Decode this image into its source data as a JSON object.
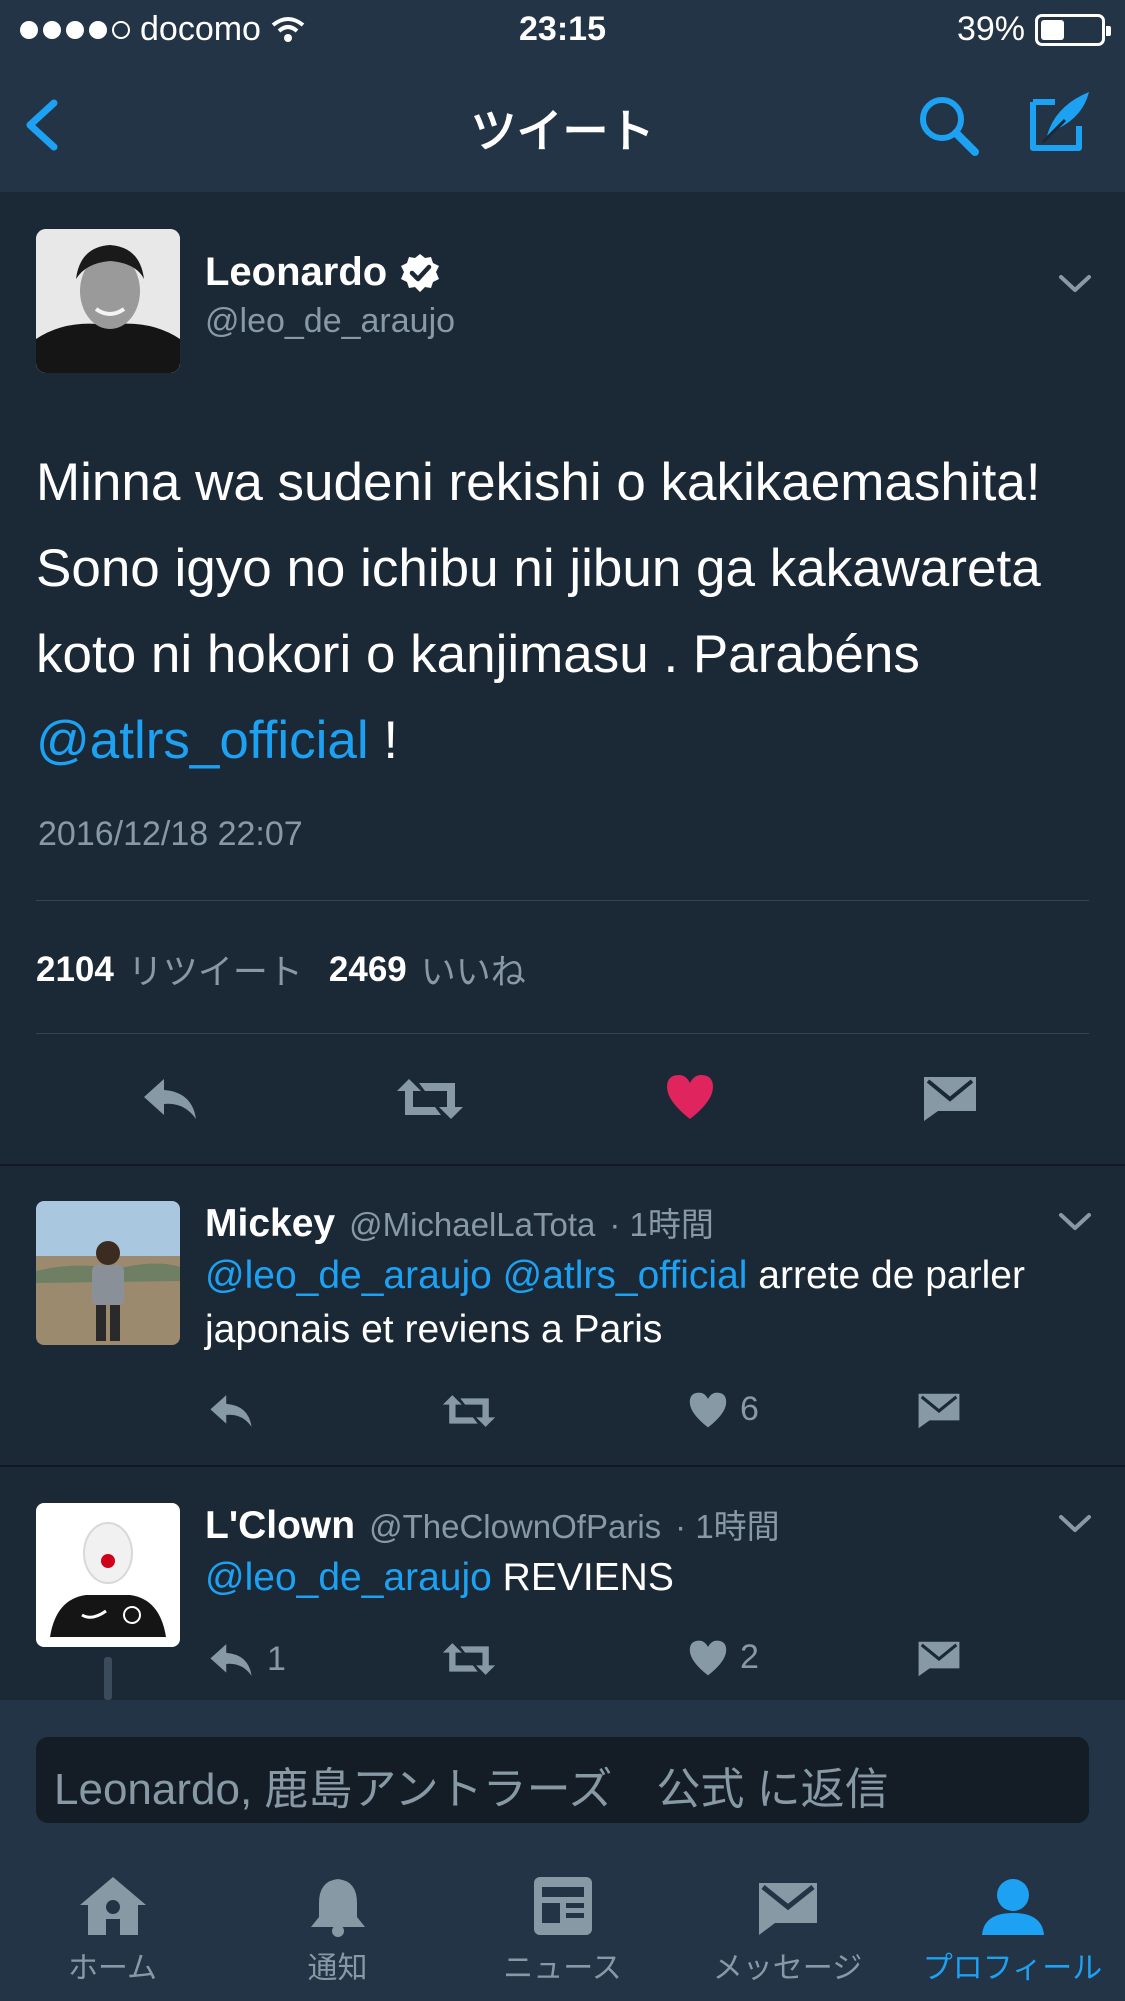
{
  "status_bar": {
    "carrier": "docomo",
    "time": "23:15",
    "battery": "39%",
    "battery_level": 0.39
  },
  "navbar": {
    "title": "ツイート",
    "back_icon": "chevron-left-icon",
    "search_icon": "search-icon",
    "compose_icon": "compose-icon"
  },
  "tweet": {
    "author_name": "Leonardo",
    "author_handle": "@leo_de_araujo",
    "text_before_mention": "Minna wa sudeni rekishi o kakikaemashita! Sono igyo no ichibu ni jibun ga kakawareta koto ni hokori o kanjimasu . Parabéns ",
    "mention": "@atlrs_official",
    "text_after_mention": " !",
    "date": "2016/12/18 22:07",
    "retweet_count": "2104",
    "retweet_label": "リツイート",
    "like_count": "2469",
    "like_label": "いいね",
    "liked": true
  },
  "replies": [
    {
      "name": "Mickey",
      "handle": "@MichaelLaTota",
      "time": "· 1時間",
      "mention1": "@leo_de_araujo",
      "mention2": "@atlrs_official",
      "text": " arrete de parler japonais et reviens a Paris",
      "reply_count": "",
      "like_count": "6"
    },
    {
      "name": "L'Clown",
      "handle": "@TheClownOfParis",
      "time": "· 1時間",
      "mention1": "@leo_de_araujo",
      "text": " REVIENS",
      "reply_count": "1",
      "like_count": "2"
    }
  ],
  "reply_box": {
    "placeholder": "Leonardo, 鹿島アントラーズ　公式 に返信"
  },
  "tabs": [
    {
      "label": "ホーム",
      "icon": "home-icon"
    },
    {
      "label": "通知",
      "icon": "bell-icon"
    },
    {
      "label": "ニュース",
      "icon": "news-icon"
    },
    {
      "label": "メッセージ",
      "icon": "envelope-icon"
    },
    {
      "label": "プロフィール",
      "icon": "profile-icon",
      "active": true
    }
  ],
  "colors": {
    "background": "#1b2836",
    "bar": "#243447",
    "accent": "#1da1f2",
    "like": "#e0245e",
    "muted": "#8899a6"
  }
}
